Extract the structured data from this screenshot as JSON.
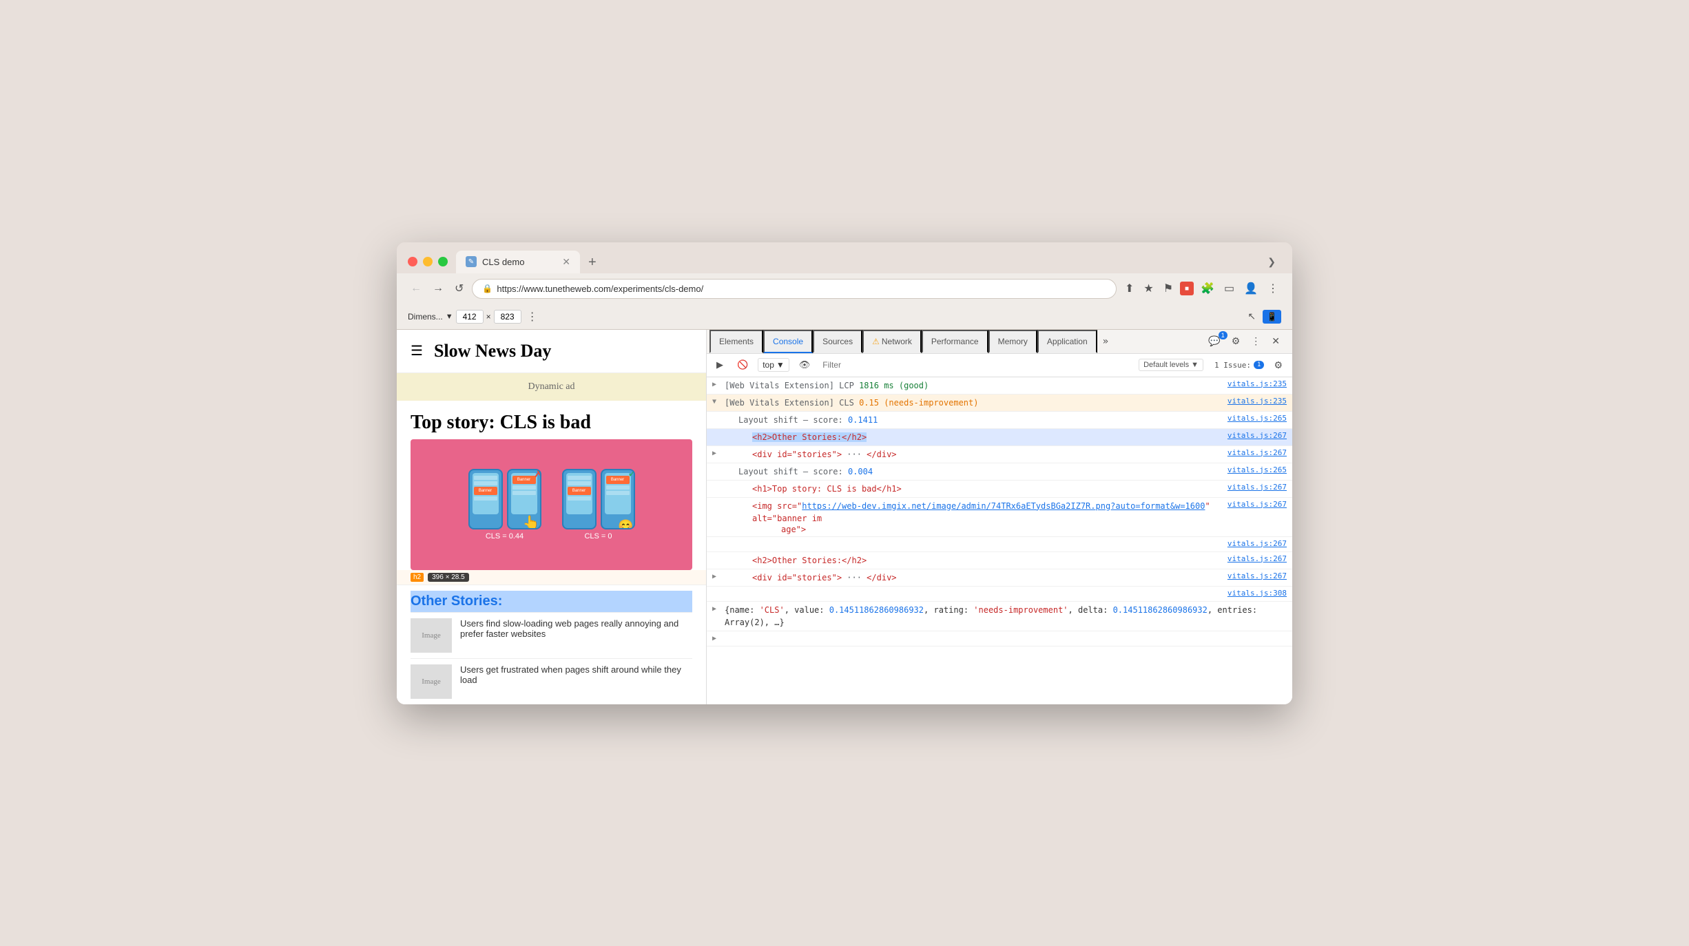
{
  "browser": {
    "tab_title": "CLS demo",
    "tab_icon": "✎",
    "url": "https://www.tunetheweb.com/experiments/cls-demo/",
    "new_tab_btn": "+",
    "chevron": "❯"
  },
  "devtools_bar": {
    "dimensions_label": "Dimens...",
    "width": "412",
    "cross": "×",
    "height": "823",
    "more_btn": "⋮"
  },
  "devtools": {
    "tabs": [
      {
        "label": "Elements",
        "active": false
      },
      {
        "label": "Console",
        "active": true
      },
      {
        "label": "Sources",
        "active": false
      },
      {
        "label": "Network",
        "active": false,
        "warning": true
      },
      {
        "label": "Performance",
        "active": false
      },
      {
        "label": "Memory",
        "active": false
      },
      {
        "label": "Application",
        "active": false
      }
    ],
    "tabs_more": "»",
    "badge_count": "1",
    "settings_icon": "⚙",
    "more_icon": "⋮",
    "close_icon": "×",
    "console_bar": {
      "play_btn": "▶",
      "ban_btn": "🚫",
      "top_label": "top",
      "chevron": "▼",
      "eye_btn": "👁",
      "filter_placeholder": "Filter",
      "default_levels": "Default levels",
      "levels_chevron": "▼",
      "issues_label": "1 Issue:",
      "issues_count": "1",
      "settings_icon": "⚙"
    },
    "console_output": [
      {
        "id": "row1",
        "indent": 0,
        "expand": "▶",
        "parts": [
          {
            "text": "[Web Vitals Extension] ",
            "class": "web-vitals-ext"
          },
          {
            "text": "LCP ",
            "class": "metric-name"
          },
          {
            "text": "1816 ms ",
            "class": "metric-value-good"
          },
          {
            "text": "(good)",
            "class": "metric-rating-good"
          }
        ],
        "source": "vitals.js:235",
        "style": "lcp-row"
      },
      {
        "id": "row2",
        "indent": 0,
        "expand": "▼",
        "parts": [
          {
            "text": "[Web Vitals Extension] ",
            "class": "web-vitals-ext"
          },
          {
            "text": "CLS ",
            "class": "metric-name"
          },
          {
            "text": "0.15 ",
            "class": "metric-value-bad"
          },
          {
            "text": "(needs-improvement)",
            "class": "metric-rating-bad"
          }
        ],
        "source": "vitals.js:235",
        "style": "cls-row selected"
      },
      {
        "id": "row3",
        "indent": 1,
        "expand": "",
        "parts": [
          {
            "text": "Layout shift – score:  ",
            "class": "label-text"
          },
          {
            "text": "0.1411",
            "class": "score-value"
          }
        ],
        "source": "vitals.js:265",
        "style": ""
      },
      {
        "id": "row4",
        "indent": 2,
        "expand": "",
        "parts": [
          {
            "text": "<h2>Other Stories:</h2>",
            "class": "html-tag",
            "highlight": true
          }
        ],
        "source": "vitals.js:267",
        "style": "highlighted"
      },
      {
        "id": "row5",
        "indent": 2,
        "expand": "▶",
        "parts": [
          {
            "text": "<div id=\"stories\">",
            "class": "html-tag"
          },
          {
            "text": " ··· ",
            "class": "label-text"
          },
          {
            "text": "</div>",
            "class": "html-tag"
          }
        ],
        "source": "vitals.js:267",
        "style": ""
      },
      {
        "id": "row6",
        "indent": 1,
        "expand": "",
        "parts": [
          {
            "text": "Layout shift – score:  ",
            "class": "label-text"
          },
          {
            "text": "0.004",
            "class": "score-value"
          }
        ],
        "source": "vitals.js:265",
        "style": ""
      },
      {
        "id": "row7",
        "indent": 2,
        "expand": "",
        "parts": [
          {
            "text": "<h1>Top story: CLS is bad</h1>",
            "class": "html-tag"
          }
        ],
        "source": "vitals.js:267",
        "style": ""
      },
      {
        "id": "row8",
        "indent": 2,
        "expand": "",
        "parts": [
          {
            "text": "",
            "class": ""
          },
          {
            "text": "",
            "class": ""
          }
        ],
        "source": "vitals.js:267",
        "style": "",
        "is_img": true,
        "img_parts": [
          {
            "text": "<img src=\"",
            "class": "html-tag"
          },
          {
            "text": "https://web-dev.imgix.net/image/admin/74TRx6aETydsBGa2IZ7R.png?auto=format&w=1600",
            "class": "html-attr link"
          },
          {
            "text": "\" alt=\"banner im",
            "class": "html-tag"
          }
        ],
        "img_line2": "age\">"
      },
      {
        "id": "row9",
        "indent": 2,
        "expand": "",
        "parts": [
          {
            "text": "<h2>Other Stories:</h2>",
            "class": "html-tag"
          }
        ],
        "source": "vitals.js:267",
        "style": ""
      },
      {
        "id": "row10",
        "indent": 2,
        "expand": "▶",
        "parts": [
          {
            "text": "<div id=\"stories\">",
            "class": "html-tag"
          },
          {
            "text": " ··· ",
            "class": "label-text"
          },
          {
            "text": "</div>",
            "class": "html-tag"
          }
        ],
        "source": "vitals.js:267",
        "style": ""
      },
      {
        "id": "row11",
        "indent": 0,
        "expand": "",
        "parts": [],
        "source": "vitals.js:308",
        "style": "",
        "is_object": true,
        "obj_text": "{name: 'CLS', value: 0.14511862860986932, rating: 'needs-improvement', delta: 0.14511862860986932, entries: Array(2), …}"
      },
      {
        "id": "row12",
        "indent": 0,
        "expand": "▶",
        "parts": [],
        "source": "",
        "style": ""
      }
    ]
  },
  "webpage": {
    "site_title": "Slow News Day",
    "ad_text": "Dynamic ad",
    "article_title": "Top story: CLS is bad",
    "cls_left_label": "CLS = 0.44",
    "cls_right_label": "CLS = 0",
    "h2_label": "h2",
    "h2_size": "396 × 28.5",
    "other_stories_title": "Other Stories:",
    "stories": [
      {
        "image_label": "Image",
        "text": "Users find slow-loading web pages really annoying and prefer faster websites"
      },
      {
        "image_label": "Image",
        "text": "Users get frustrated when pages shift around while they load"
      }
    ]
  }
}
